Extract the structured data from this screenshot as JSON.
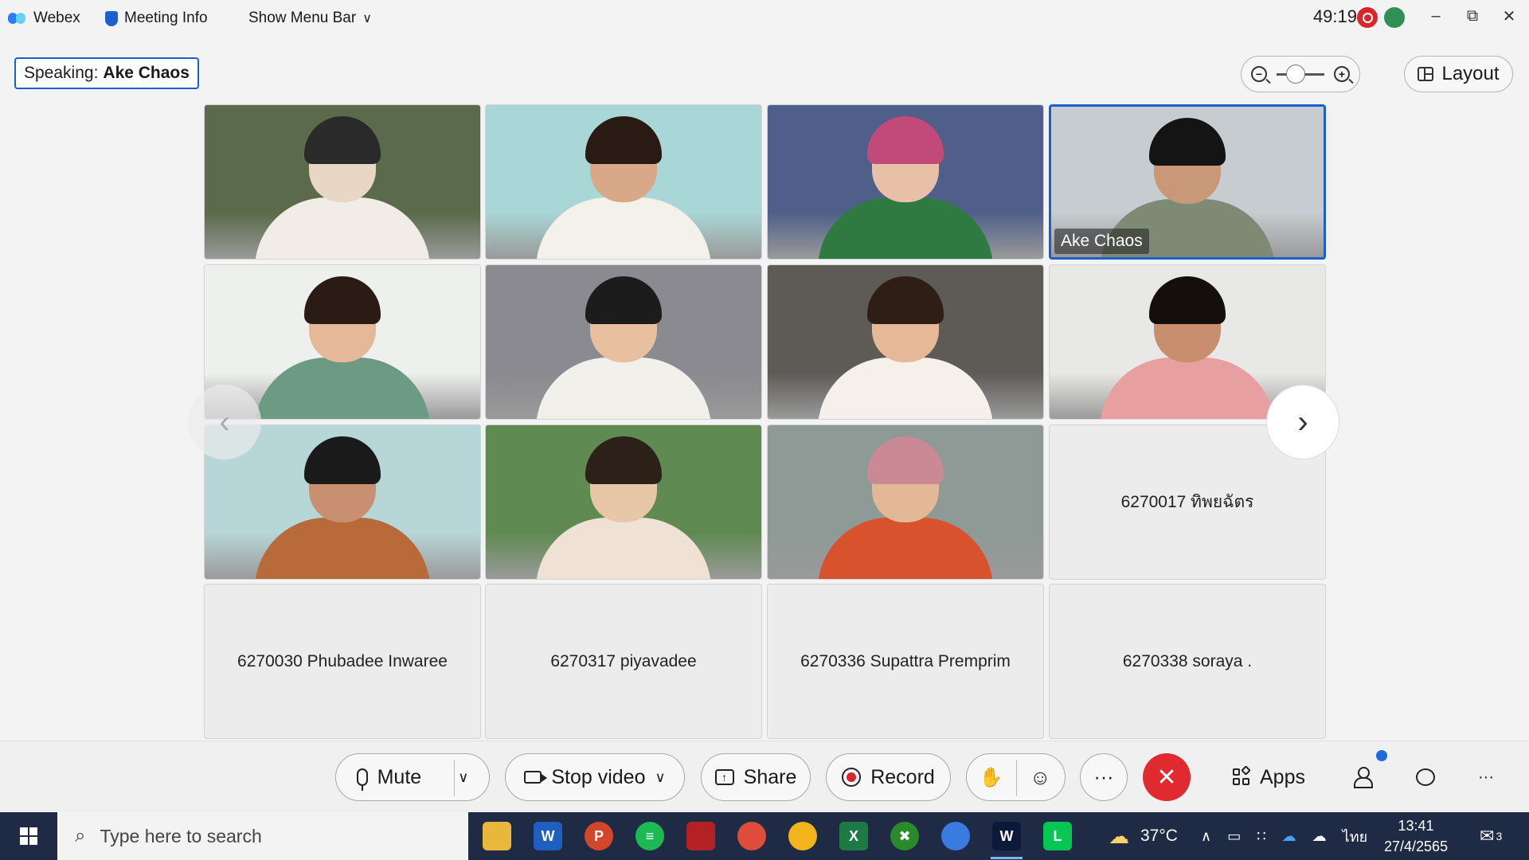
{
  "titlebar": {
    "app_name": "Webex",
    "meeting_info": "Meeting Info",
    "show_menu_bar": "Show Menu Bar",
    "timer": "49:19"
  },
  "speaking": {
    "label": "Speaking:",
    "name": "Ake Chaos"
  },
  "layout_button": "Layout",
  "zoom_symbols": {
    "out": "−",
    "in": "+"
  },
  "tiles": [
    {
      "name": "",
      "video": true
    },
    {
      "name": "",
      "video": true
    },
    {
      "name": "",
      "video": true
    },
    {
      "name": "Ake Chaos",
      "video": true,
      "active": true
    },
    {
      "name": "",
      "video": true
    },
    {
      "name": "",
      "video": true
    },
    {
      "name": "",
      "video": true
    },
    {
      "name": "",
      "video": true
    },
    {
      "name": "",
      "video": true
    },
    {
      "name": "",
      "video": true
    },
    {
      "name": "",
      "video": true
    },
    {
      "name": "6270017 ทิพยฉัตร",
      "video": false
    },
    {
      "name": "6270030 Phubadee Inwaree",
      "video": false
    },
    {
      "name": "6270317 piyavadee",
      "video": false
    },
    {
      "name": "6270336 Supattra Premprim",
      "video": false
    },
    {
      "name": "6270338 soraya .",
      "video": false
    }
  ],
  "controls": {
    "mute": "Mute",
    "stop_video": "Stop video",
    "share": "Share",
    "record": "Record",
    "more": "···",
    "end": "✕",
    "apps": "Apps",
    "overflow": "···"
  },
  "taskbar": {
    "search_placeholder": "Type here to search",
    "temperature": "37°C",
    "language": "ไทย",
    "time": "13:41",
    "date": "27/4/2565",
    "notifications": "3"
  },
  "colors": {
    "accent": "#1b5fcf",
    "end_call": "#e02a2f",
    "record_dot": "#d9262c",
    "taskbar": "#1f2a44"
  }
}
